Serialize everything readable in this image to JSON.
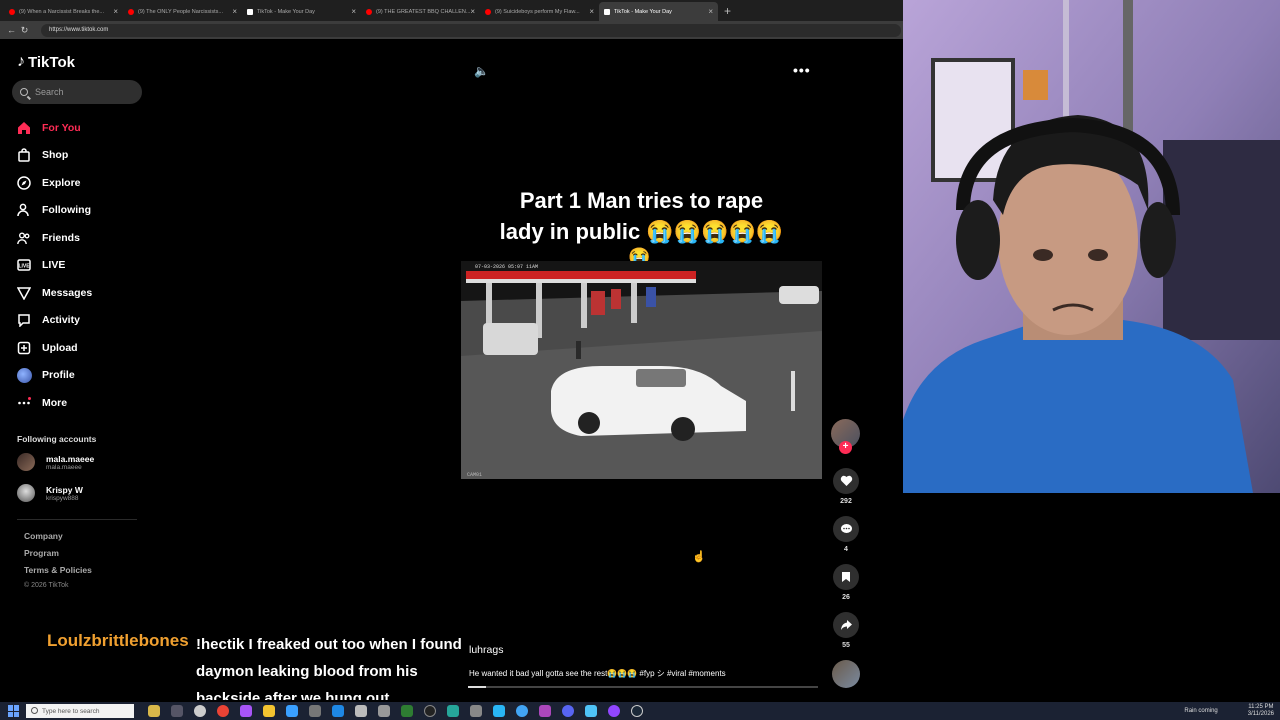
{
  "browser": {
    "tabs": [
      {
        "label": "(9) When a Narcissist Breaks the...",
        "icon": "youtube-icon"
      },
      {
        "label": "(9) The ONLY People Narcissists...",
        "icon": "youtube-icon"
      },
      {
        "label": "TikTok - Make Your Day",
        "icon": "tiktok-icon"
      },
      {
        "label": "(9) THE GREATEST BBQ CHALLEN...",
        "icon": "youtube-icon"
      },
      {
        "label": "(9) Suicideboys perform My Flaw...",
        "icon": "youtube-icon"
      },
      {
        "label": "TikTok - Make Your Day",
        "icon": "tiktok-icon",
        "active": true
      }
    ],
    "url": "https://www.tiktok.com"
  },
  "tiktok": {
    "brand": "TikTok",
    "search_placeholder": "Search",
    "nav": [
      {
        "label": "For You",
        "icon": "home-icon",
        "active": true
      },
      {
        "label": "Shop",
        "icon": "shopping-bag-icon"
      },
      {
        "label": "Explore",
        "icon": "compass-icon"
      },
      {
        "label": "Following",
        "icon": "user-follow-icon"
      },
      {
        "label": "Friends",
        "icon": "friends-icon"
      },
      {
        "label": "LIVE",
        "icon": "live-icon"
      },
      {
        "label": "Messages",
        "icon": "messages-icon"
      },
      {
        "label": "Activity",
        "icon": "activity-icon"
      },
      {
        "label": "Upload",
        "icon": "upload-icon"
      },
      {
        "label": "Profile",
        "icon": "profile-avatar"
      },
      {
        "label": "More",
        "icon": "more-dots-icon"
      }
    ],
    "following_title": "Following accounts",
    "following": [
      {
        "name": "mala.maeee",
        "handle": "mala.maeee"
      },
      {
        "name": "Krispy W",
        "handle": "krispyw888"
      }
    ],
    "footer": {
      "company": "Company",
      "program": "Program",
      "terms": "Terms & Policies",
      "copyright": "© 2026 TikTok"
    },
    "post": {
      "caption_line1": "Part 1 Man tries to rape",
      "caption_line2": "lady in public 😭😭😭😭😭",
      "caption_line3": "😭",
      "cctv_timestamp": "07-03-2026 05:07 11AM",
      "cctv_label": "CAM01",
      "username": "luhrags",
      "description": "He wanted it bad yall gotta see the rest😭😭😭 #fyp シ #viral #moments",
      "likes": "292",
      "comments": "4",
      "saves": "26",
      "shares": "55",
      "progress": 0.05
    }
  },
  "chat": {
    "username": "Loulzbrittlebones",
    "message": "!hectik I freaked out too when I found daymon leaking blood from his backside after we hung out",
    "username_color": "#f0a030"
  },
  "taskbar": {
    "search_placeholder": "Type here to search",
    "weather": "Rain coming",
    "time": "11:25 PM",
    "date": "3/11/2026"
  }
}
